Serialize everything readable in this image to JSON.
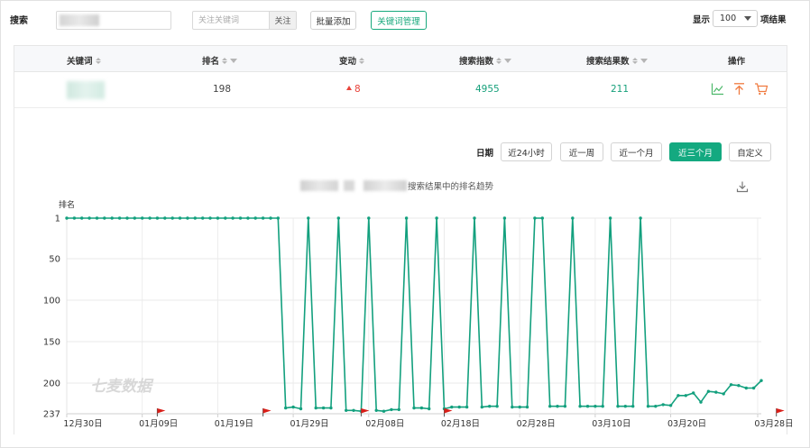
{
  "toolbar": {
    "search_label": "搜索",
    "keyword_placeholder": "关注关键词",
    "follow_label": "关注",
    "batch_add_label": "批量添加",
    "manage_label": "关键词管理",
    "show_label": "显示",
    "page_size": "100",
    "result_unit": "项结果"
  },
  "table": {
    "headers": [
      "关键词",
      "排名",
      "变动",
      "搜索指数",
      "搜索结果数",
      "操作"
    ],
    "row": {
      "rank": "198",
      "change": "8",
      "search_index": "4955",
      "result_count": "211"
    }
  },
  "range": {
    "label": "日期",
    "options": [
      "近24小时",
      "近一周",
      "近一个月",
      "近三个月",
      "自定义"
    ],
    "active": "近三个月"
  },
  "chart_title_suffix": "搜索结果中的排名趋势",
  "watermark": "七麦数据",
  "colors": {
    "accent": "#14a980",
    "line": "#13a07e",
    "down": "#e8433a",
    "flag": "#d91e18"
  },
  "chart_data": {
    "type": "line",
    "ylabel": "排名",
    "y_axis": "inverted",
    "yticks": [
      1,
      50,
      100,
      150,
      200,
      237
    ],
    "ylim": [
      237,
      1
    ],
    "xticks": [
      "12月30日",
      "01月09日",
      "01月19日",
      "01月29日",
      "02月08日",
      "02月18日",
      "02月28日",
      "03月10日",
      "03月20日",
      "03月28日"
    ],
    "grid": true,
    "series": [
      {
        "values": [
          1,
          1,
          1,
          1,
          1,
          1,
          1,
          1,
          1,
          1,
          1,
          1,
          1,
          1,
          1,
          1,
          1,
          1,
          1,
          1,
          1,
          1,
          1,
          1,
          1,
          1,
          1,
          1,
          1,
          230,
          229,
          231,
          1,
          230,
          230,
          230,
          1,
          233,
          233,
          234,
          1,
          233,
          234,
          232,
          232,
          1,
          230,
          230,
          231,
          1,
          231,
          229,
          229,
          229,
          1,
          229,
          228,
          228,
          1,
          229,
          229,
          229,
          1,
          1,
          228,
          228,
          228,
          1,
          228,
          228,
          228,
          228,
          1,
          228,
          228,
          228,
          1,
          228,
          228,
          226,
          227,
          215,
          215,
          212,
          223,
          210,
          211,
          213,
          202,
          203,
          206,
          206,
          197
        ]
      }
    ]
  }
}
